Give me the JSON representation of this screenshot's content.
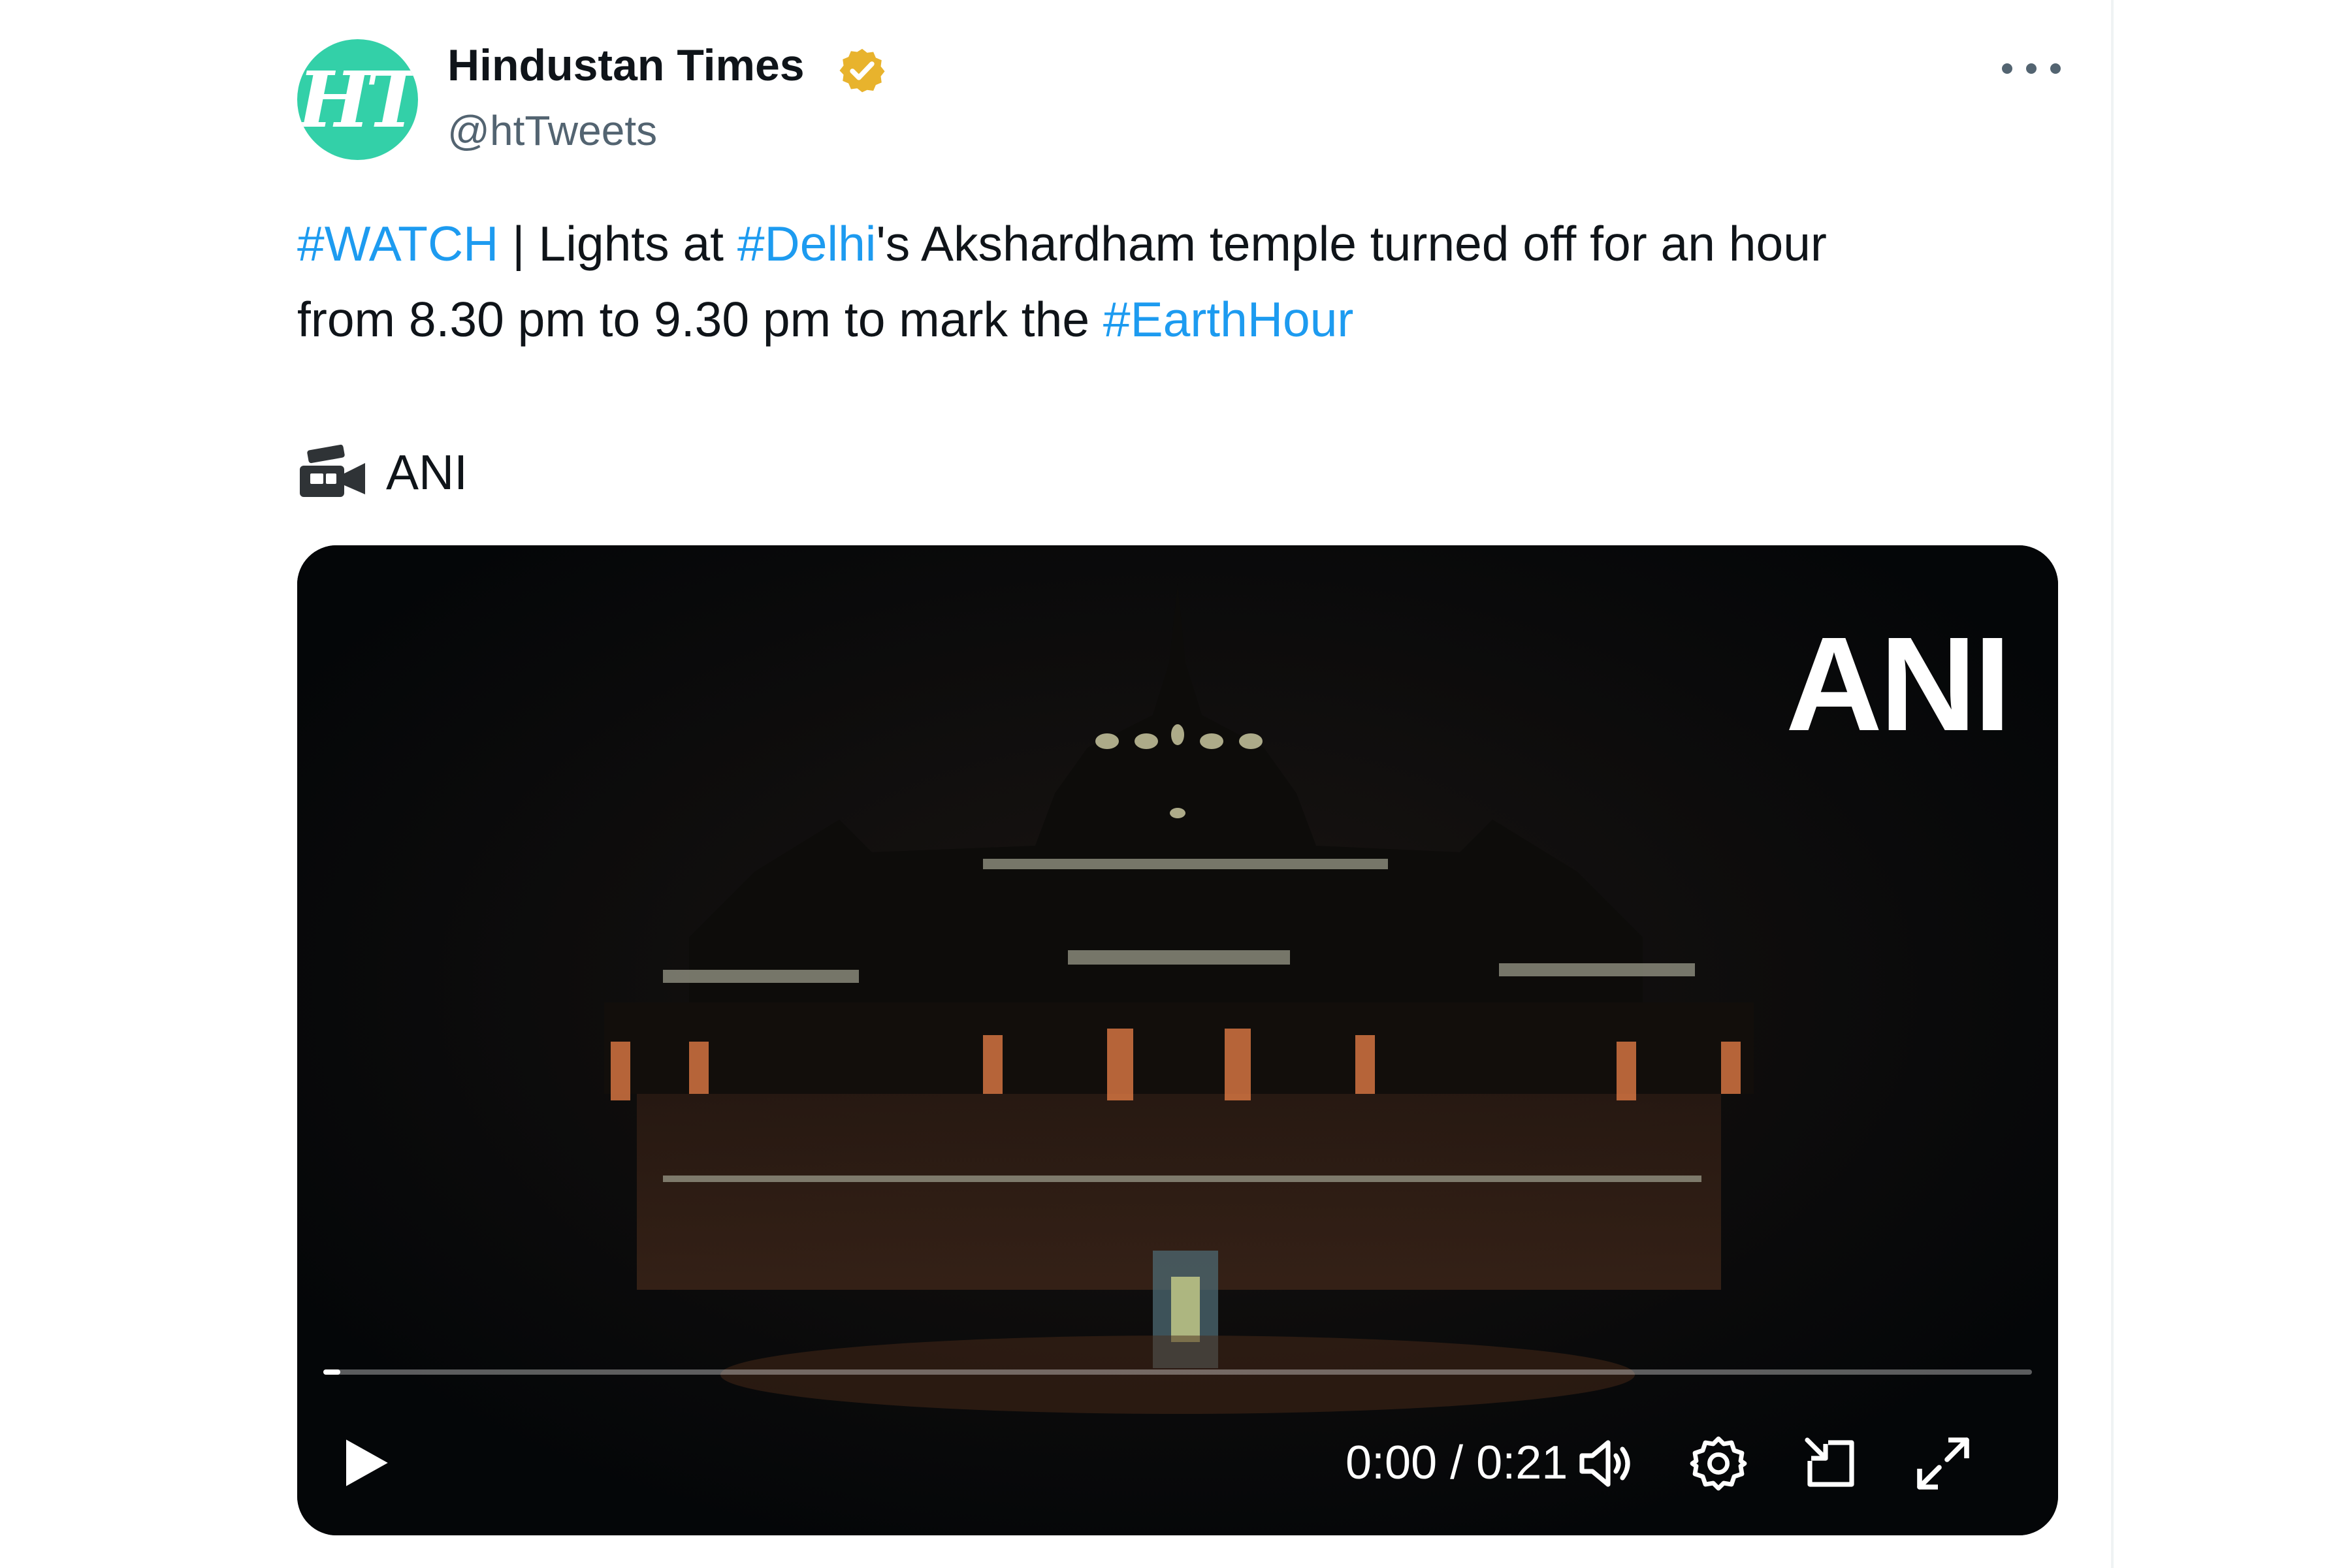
{
  "author": {
    "name": "Hindustan Times",
    "handle": "@htTweets",
    "avatar_text": "HT",
    "verified": true,
    "verified_icon": "verified-badge-icon",
    "avatar_color": "#33d0a8",
    "badge_color": "#e8b32d"
  },
  "menu": {
    "icon": "more-horizontal-icon"
  },
  "tweet": {
    "line1": {
      "tag1": "#WATCH",
      "text1": " | Lights at ",
      "tag2": "#Delhi",
      "text2": "'s Akshardham temple turned off for an hour"
    },
    "line2": {
      "text1": "from 8.30 pm to 9.30 pm to mark the ",
      "tag1": "#EarthHour"
    },
    "credit_icon": "video-camera-icon",
    "credit": "ANI",
    "link_color": "#1d9bf0"
  },
  "video": {
    "watermark": "ANI",
    "progress": 0.01,
    "current_time": "0:00",
    "duration": "0:21",
    "time_display": "0:00 / 0:21",
    "controls": {
      "play_icon": "play-icon",
      "volume_icon": "volume-icon",
      "settings_icon": "settings-icon",
      "popout_icon": "pop-out-icon",
      "fullscreen_icon": "fullscreen-icon"
    }
  }
}
